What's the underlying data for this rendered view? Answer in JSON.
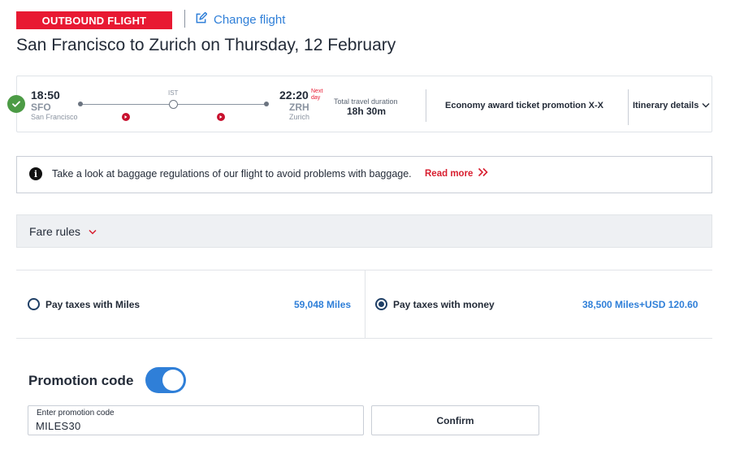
{
  "header": {
    "badge": "OUTBOUND FLIGHT",
    "change_flight": "Change flight",
    "title": "San Francisco to Zurich on Thursday, 12 February"
  },
  "flight": {
    "departure": {
      "time": "18:50",
      "code": "SFO",
      "city": "San Francisco"
    },
    "stop": {
      "code": "IST"
    },
    "arrival": {
      "time": "22:20",
      "next_day": "Next day",
      "code": "ZRH",
      "city": "Zurich"
    },
    "duration_label": "Total travel duration",
    "duration_value": "18h 30m",
    "fare_name": "Economy award ticket promotion X-X",
    "itinerary_details": "Itinerary details",
    "status_icon": "check-icon",
    "airline_icon": "turkish-airlines-logo"
  },
  "notice": {
    "text": "Take a look at baggage regulations of our flight to avoid problems with baggage.",
    "read_more": "Read more"
  },
  "fare_rules": {
    "label": "Fare rules"
  },
  "payment": {
    "options": [
      {
        "label": "Pay taxes with Miles",
        "amount": "59,048 Miles",
        "selected": false
      },
      {
        "label": "Pay taxes with money",
        "amount": "38,500 Miles+USD 120.60",
        "selected": true
      }
    ]
  },
  "promotion": {
    "title": "Promotion code",
    "toggle_on": true,
    "field_label": "Enter promotion code",
    "field_value": "MILES30",
    "confirm": "Confirm"
  },
  "colors": {
    "brand_red": "#e81932",
    "link_blue": "#2f7fd8",
    "success_green": "#4c9b45",
    "text_dark": "#232b38"
  }
}
